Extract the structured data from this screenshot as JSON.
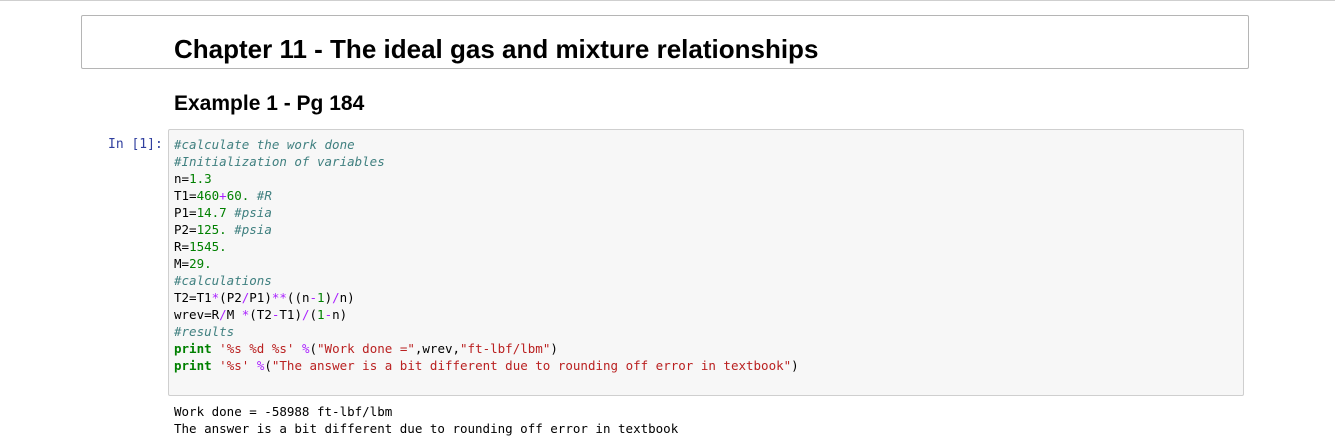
{
  "chapter_title": "Chapter 11 - The ideal gas and mixture relationships",
  "example_title": "Example 1 - Pg 184",
  "cell": {
    "prompt": "In [1]:",
    "code": {
      "l1": "#calculate the work done",
      "l2": "#Initialization of variables",
      "l3": {
        "a": "n=",
        "b": "1.3"
      },
      "l4": {
        "a": "T1=",
        "b": "460",
        "c": "+",
        "d": "60.",
        "e": " ",
        "f": "#R"
      },
      "l5": {
        "a": "P1=",
        "b": "14.7",
        "c": " ",
        "d": "#psia"
      },
      "l6": {
        "a": "P2=",
        "b": "125.",
        "c": " ",
        "d": "#psia"
      },
      "l7": {
        "a": "R=",
        "b": "1545."
      },
      "l8": {
        "a": "M=",
        "b": "29."
      },
      "l9": "#calculations",
      "l10": {
        "a": "T2=T1",
        "b": "*",
        "c": "(P2",
        "d": "/",
        "e": "P1)",
        "f": "**",
        "g": "((n",
        "h": "-",
        "i": "1",
        "j": ")",
        "k": "/",
        "l": "n)"
      },
      "l11": {
        "a": "wrev=R",
        "b": "/",
        "c": "M ",
        "d": "*",
        "e": "(T2",
        "f": "-",
        "g": "T1)",
        "h": "/",
        "i": "(",
        "j": "1",
        "k": "-",
        "l": "n)"
      },
      "l12": "#results",
      "l13": {
        "a": "print",
        "b": " ",
        "c": "'%s %d %s'",
        "d": " ",
        "e": "%",
        "f": "(",
        "g": "\"Work done =\"",
        "h": ",wrev,",
        "i": "\"ft-lbf/lbm\"",
        "j": ")"
      },
      "l14": {
        "a": "print",
        "b": " ",
        "c": "'%s'",
        "d": " ",
        "e": "%",
        "f": "(",
        "g": "\"The answer is a bit different due to rounding off error in textbook\"",
        "h": ")"
      }
    },
    "output": {
      "line1": "Work done = -58988 ft-lbf/lbm",
      "line2": "The answer is a bit different due to rounding off error in textbook"
    }
  }
}
